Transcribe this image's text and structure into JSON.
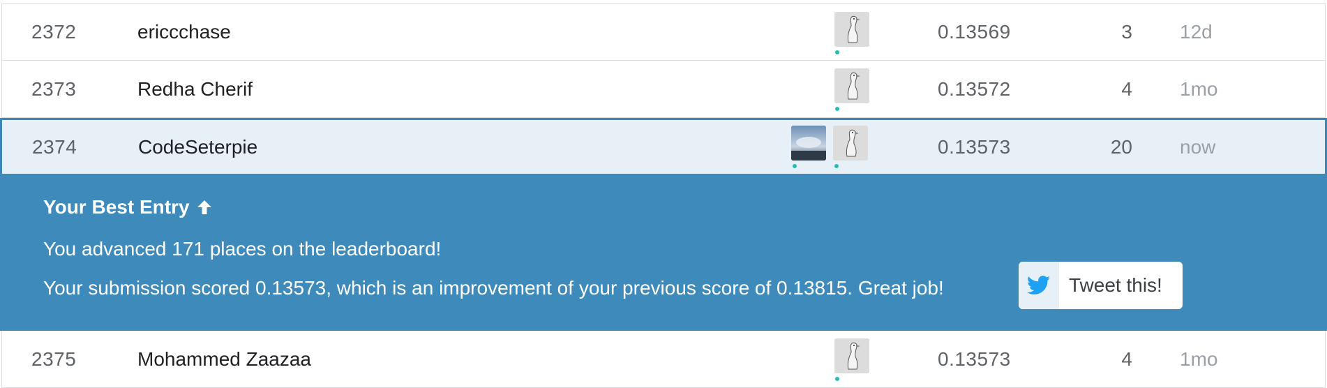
{
  "leaderboard": {
    "rows": [
      {
        "rank": "2372",
        "team": "ericcchase",
        "score": "0.13569",
        "entries": "3",
        "last": "12d",
        "avatar": "goose-avatar"
      },
      {
        "rank": "2373",
        "team": "Redha Cherif",
        "score": "0.13572",
        "entries": "4",
        "last": "1mo",
        "avatar": "goose-avatar"
      },
      {
        "rank": "2374",
        "team": "CodeSeterpie",
        "score": "0.13573",
        "entries": "20",
        "last": "now",
        "avatar": "goose-avatar",
        "extra_avatar": "sky-photo-avatar"
      },
      {
        "rank": "2375",
        "team": "Mohammed Zaazaa",
        "score": "0.13573",
        "entries": "4",
        "last": "1mo",
        "avatar": "goose-avatar"
      }
    ]
  },
  "banner": {
    "title": "Your Best Entry",
    "title_icon": "arrow-up-icon",
    "message_advanced": "You advanced 171 places on the leaderboard!",
    "message_score": "Your submission scored 0.13573, which is an improvement of your previous score of 0.13815. Great job!",
    "tweet_label": "Tweet this!",
    "tweet_icon": "twitter-bird-icon",
    "background_color": "#3d8abb"
  },
  "colors": {
    "highlight_row": "#e8f0f7",
    "highlight_border": "#3d86b8",
    "twitter_blue": "#1da1f2",
    "online_dot": "#20beb6"
  }
}
